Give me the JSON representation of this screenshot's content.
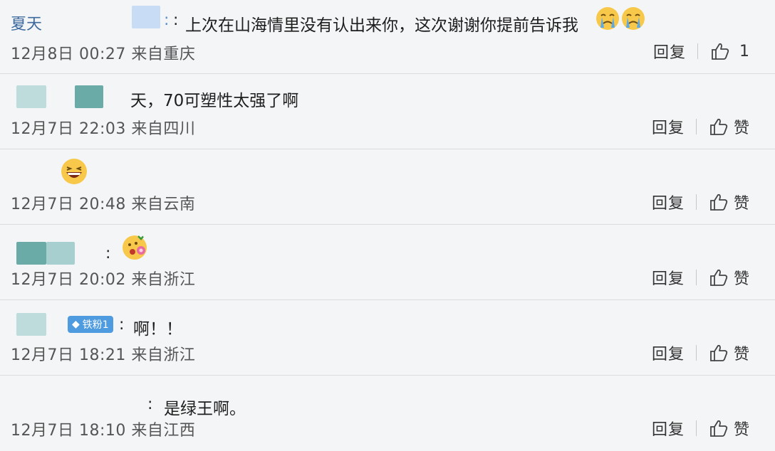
{
  "comments": [
    {
      "user": "夏天",
      "text": "上次在山海情里没有认出来你，这次谢谢你提前告诉我",
      "time": "12月8日 00:27 来自重庆",
      "reply": "回复",
      "like": "1",
      "emojis": [
        "crying-face",
        "crying-face"
      ]
    },
    {
      "user": "",
      "text": "天，70可塑性太强了啊",
      "time": "12月7日 22:03 来自四川",
      "reply": "回复",
      "like": "赞"
    },
    {
      "user": "",
      "text": "",
      "time": "12月7日 20:48 来自云南",
      "reply": "回复",
      "like": "赞",
      "emojis": [
        "laughing-face"
      ]
    },
    {
      "user": "",
      "text": "",
      "time": "12月7日 20:02 来自浙江",
      "reply": "回复",
      "like": "赞",
      "emojis": [
        "flower-face"
      ]
    },
    {
      "user": "",
      "badge": "铁粉1",
      "text": "啊！！",
      "time": "12月7日 18:21 来自浙江",
      "reply": "回复",
      "like": "赞"
    },
    {
      "user": "",
      "text": "是绿王啊。",
      "time": "12月7日 18:10 来自江西",
      "reply": "回复",
      "like": "赞"
    }
  ],
  "colon": ":",
  "colors": {
    "username": "#3d6a9e",
    "divider": "#dadce0",
    "background": "#f4f5f7",
    "badge": "#4f9be0",
    "blur_teal": "#6aaba8",
    "blur_light": "#bfdcdc",
    "blur_blue": "#c9dcf5"
  }
}
